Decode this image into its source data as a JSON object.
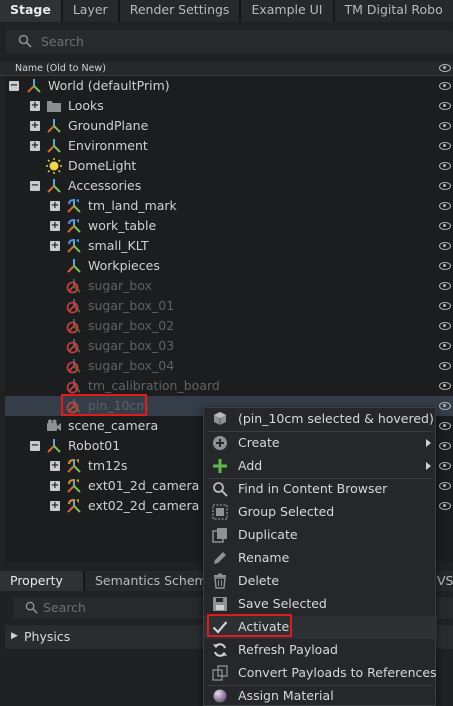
{
  "tabs": [
    "Stage",
    "Layer",
    "Render Settings",
    "Example UI",
    "TM Digital Robo"
  ],
  "search": {
    "placeholder": "Search"
  },
  "tree_header": {
    "column": "Name (Old to New)"
  },
  "tree": [
    {
      "label": "World (defaultPrim)",
      "icon": "xform-icon",
      "expander": "minus",
      "level": 0
    },
    {
      "label": "Looks",
      "icon": "folder-icon",
      "expander": "plus",
      "level": 1
    },
    {
      "label": "GroundPlane",
      "icon": "xform-icon",
      "expander": "plus",
      "level": 1
    },
    {
      "label": "Environment",
      "icon": "xform-icon",
      "expander": "plus",
      "level": 1
    },
    {
      "label": "DomeLight",
      "icon": "light-icon",
      "expander": "",
      "level": 1
    },
    {
      "label": "Accessories",
      "icon": "xform-icon",
      "expander": "minus",
      "level": 1
    },
    {
      "label": "tm_land_mark",
      "icon": "xform-ref-icon",
      "expander": "plus",
      "level": 2
    },
    {
      "label": "work_table",
      "icon": "xform-ref-icon",
      "expander": "plus",
      "level": 2
    },
    {
      "label": "small_KLT",
      "icon": "xform-ref-icon",
      "expander": "plus",
      "level": 2
    },
    {
      "label": "Workpieces",
      "icon": "xform-icon",
      "expander": "",
      "level": 2
    },
    {
      "label": "sugar_box",
      "icon": "inactive-icon",
      "expander": "",
      "level": 2,
      "inactive": true
    },
    {
      "label": "sugar_box_01",
      "icon": "inactive-icon",
      "expander": "",
      "level": 2,
      "inactive": true
    },
    {
      "label": "sugar_box_02",
      "icon": "inactive-icon",
      "expander": "",
      "level": 2,
      "inactive": true
    },
    {
      "label": "sugar_box_03",
      "icon": "inactive-icon",
      "expander": "",
      "level": 2,
      "inactive": true
    },
    {
      "label": "sugar_box_04",
      "icon": "inactive-icon",
      "expander": "",
      "level": 2,
      "inactive": true
    },
    {
      "label": "tm_calibration_board",
      "icon": "inactive-icon",
      "expander": "",
      "level": 2,
      "inactive": true
    },
    {
      "label": "pin_10cm",
      "icon": "inactive-icon",
      "expander": "",
      "level": 2,
      "inactive": true,
      "selected": true
    },
    {
      "label": "scene_camera",
      "icon": "camera-icon",
      "expander": "",
      "level": 1
    },
    {
      "label": "Robot01",
      "icon": "xform-icon",
      "expander": "minus",
      "level": 1
    },
    {
      "label": "tm12s",
      "icon": "xform-ref-orange-icon",
      "expander": "plus",
      "level": 2
    },
    {
      "label": "ext01_2d_camera",
      "icon": "xform-ref-orange-icon",
      "expander": "plus",
      "level": 2
    },
    {
      "label": "ext02_2d_camera",
      "icon": "xform-ref-orange-icon",
      "expander": "plus",
      "level": 2
    }
  ],
  "bottom_tabs": [
    "Property",
    "Semantics Schema E",
    "VS"
  ],
  "property_search": {
    "placeholder": "Search"
  },
  "physics_section": {
    "label": "Physics"
  },
  "context_menu": {
    "header": "(pin_10cm selected & hovered)",
    "items": [
      {
        "label": "Create",
        "icon": "plus-circle-icon",
        "submenu": true
      },
      {
        "label": "Add",
        "icon": "plus-icon",
        "submenu": true
      },
      {
        "label": "Find in Content Browser",
        "icon": "search-icon"
      },
      {
        "label": "Group Selected",
        "icon": "group-icon"
      },
      {
        "label": "Duplicate",
        "icon": "duplicate-icon"
      },
      {
        "label": "Rename",
        "icon": "pencil-icon"
      },
      {
        "label": "Delete",
        "icon": "trash-icon"
      },
      {
        "label": "Save Selected",
        "icon": "save-icon"
      },
      {
        "label": "Activate",
        "icon": "checkmark-icon"
      },
      {
        "label": "Refresh Payload",
        "icon": "refresh-icon"
      },
      {
        "label": "Convert Payloads to References",
        "icon": "convert-icon"
      },
      {
        "label": "Assign Material",
        "icon": "material-sphere-icon"
      }
    ]
  },
  "colors": {
    "highlight_box": "#e01b1b",
    "selection": "#343d48",
    "inactive_text": "#5f6264"
  }
}
